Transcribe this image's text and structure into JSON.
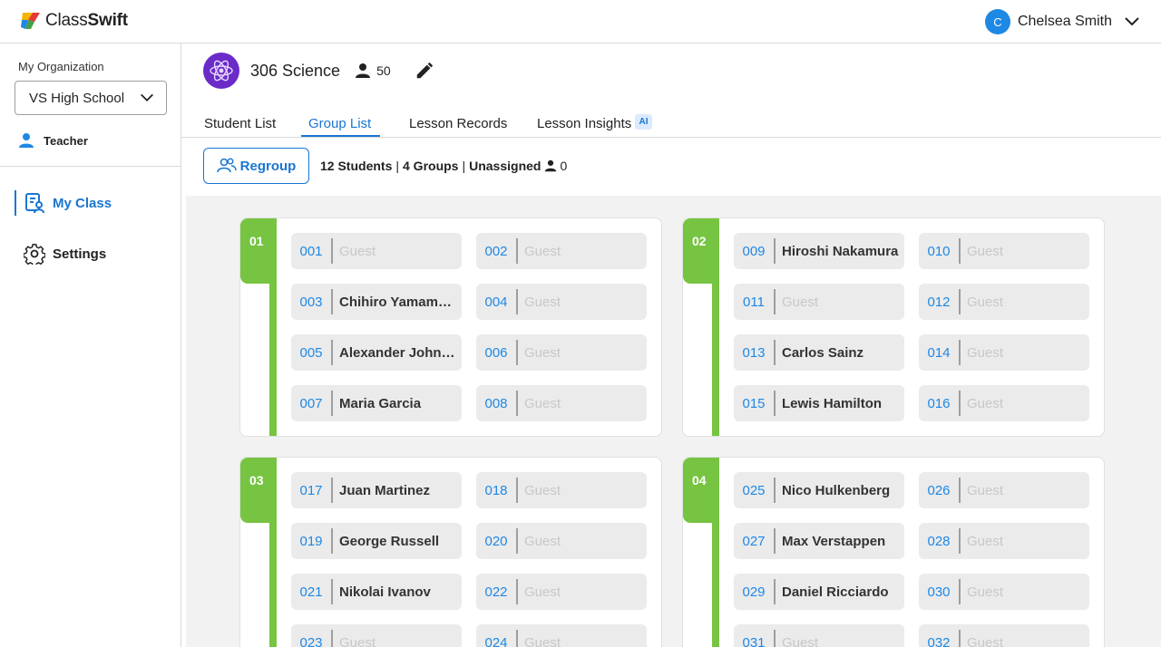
{
  "brand": {
    "name_part1": "Class",
    "name_part2": "Swift"
  },
  "user": {
    "initial": "C",
    "name": "Chelsea Smith"
  },
  "sidebar": {
    "org_label": "My Organization",
    "org_value": "VS High School",
    "role": "Teacher",
    "nav": [
      {
        "label": "My Class"
      },
      {
        "label": "Settings"
      }
    ]
  },
  "class": {
    "name": "306 Science",
    "member_count": "50"
  },
  "tabs": [
    {
      "label": "Student List"
    },
    {
      "label": "Group List"
    },
    {
      "label": "Lesson Records"
    },
    {
      "label": "Lesson Insights"
    }
  ],
  "ai_badge": "AI",
  "toolbar": {
    "regroup_label": "Regroup",
    "students": "12 Students",
    "groups": "4 Groups",
    "unassigned_label": "Unassigned",
    "unassigned_count": "0"
  },
  "colors": {
    "accent": "#1976d2",
    "group_green": "#76c442",
    "class_icon": "#6a2bc9"
  },
  "groups": [
    {
      "label": "01",
      "seats": [
        {
          "num": "001",
          "name": "Guest",
          "guest": true
        },
        {
          "num": "002",
          "name": "Guest",
          "guest": true
        },
        {
          "num": "003",
          "name": "Chihiro Yamamoto",
          "guest": false
        },
        {
          "num": "004",
          "name": "Guest",
          "guest": true
        },
        {
          "num": "005",
          "name": "Alexander Johnson",
          "guest": false
        },
        {
          "num": "006",
          "name": "Guest",
          "guest": true
        },
        {
          "num": "007",
          "name": "Maria Garcia",
          "guest": false
        },
        {
          "num": "008",
          "name": "Guest",
          "guest": true
        }
      ]
    },
    {
      "label": "02",
      "seats": [
        {
          "num": "009",
          "name": "Hiroshi Nakamura",
          "guest": false
        },
        {
          "num": "010",
          "name": "Guest",
          "guest": true
        },
        {
          "num": "011",
          "name": "Guest",
          "guest": true
        },
        {
          "num": "012",
          "name": "Guest",
          "guest": true
        },
        {
          "num": "013",
          "name": "Carlos Sainz",
          "guest": false
        },
        {
          "num": "014",
          "name": "Guest",
          "guest": true
        },
        {
          "num": "015",
          "name": "Lewis Hamilton",
          "guest": false
        },
        {
          "num": "016",
          "name": "Guest",
          "guest": true
        }
      ]
    },
    {
      "label": "03",
      "seats": [
        {
          "num": "017",
          "name": "Juan Martinez",
          "guest": false
        },
        {
          "num": "018",
          "name": "Guest",
          "guest": true
        },
        {
          "num": "019",
          "name": "George Russell",
          "guest": false
        },
        {
          "num": "020",
          "name": "Guest",
          "guest": true
        },
        {
          "num": "021",
          "name": "Nikolai Ivanov",
          "guest": false
        },
        {
          "num": "022",
          "name": "Guest",
          "guest": true
        },
        {
          "num": "023",
          "name": "Guest",
          "guest": true
        },
        {
          "num": "024",
          "name": "Guest",
          "guest": true
        }
      ]
    },
    {
      "label": "04",
      "seats": [
        {
          "num": "025",
          "name": "Nico Hulkenberg",
          "guest": false
        },
        {
          "num": "026",
          "name": "Guest",
          "guest": true
        },
        {
          "num": "027",
          "name": "Max Verstappen",
          "guest": false
        },
        {
          "num": "028",
          "name": "Guest",
          "guest": true
        },
        {
          "num": "029",
          "name": "Daniel Ricciardo",
          "guest": false
        },
        {
          "num": "030",
          "name": "Guest",
          "guest": true
        },
        {
          "num": "031",
          "name": "Guest",
          "guest": true
        },
        {
          "num": "032",
          "name": "Guest",
          "guest": true
        }
      ]
    }
  ]
}
